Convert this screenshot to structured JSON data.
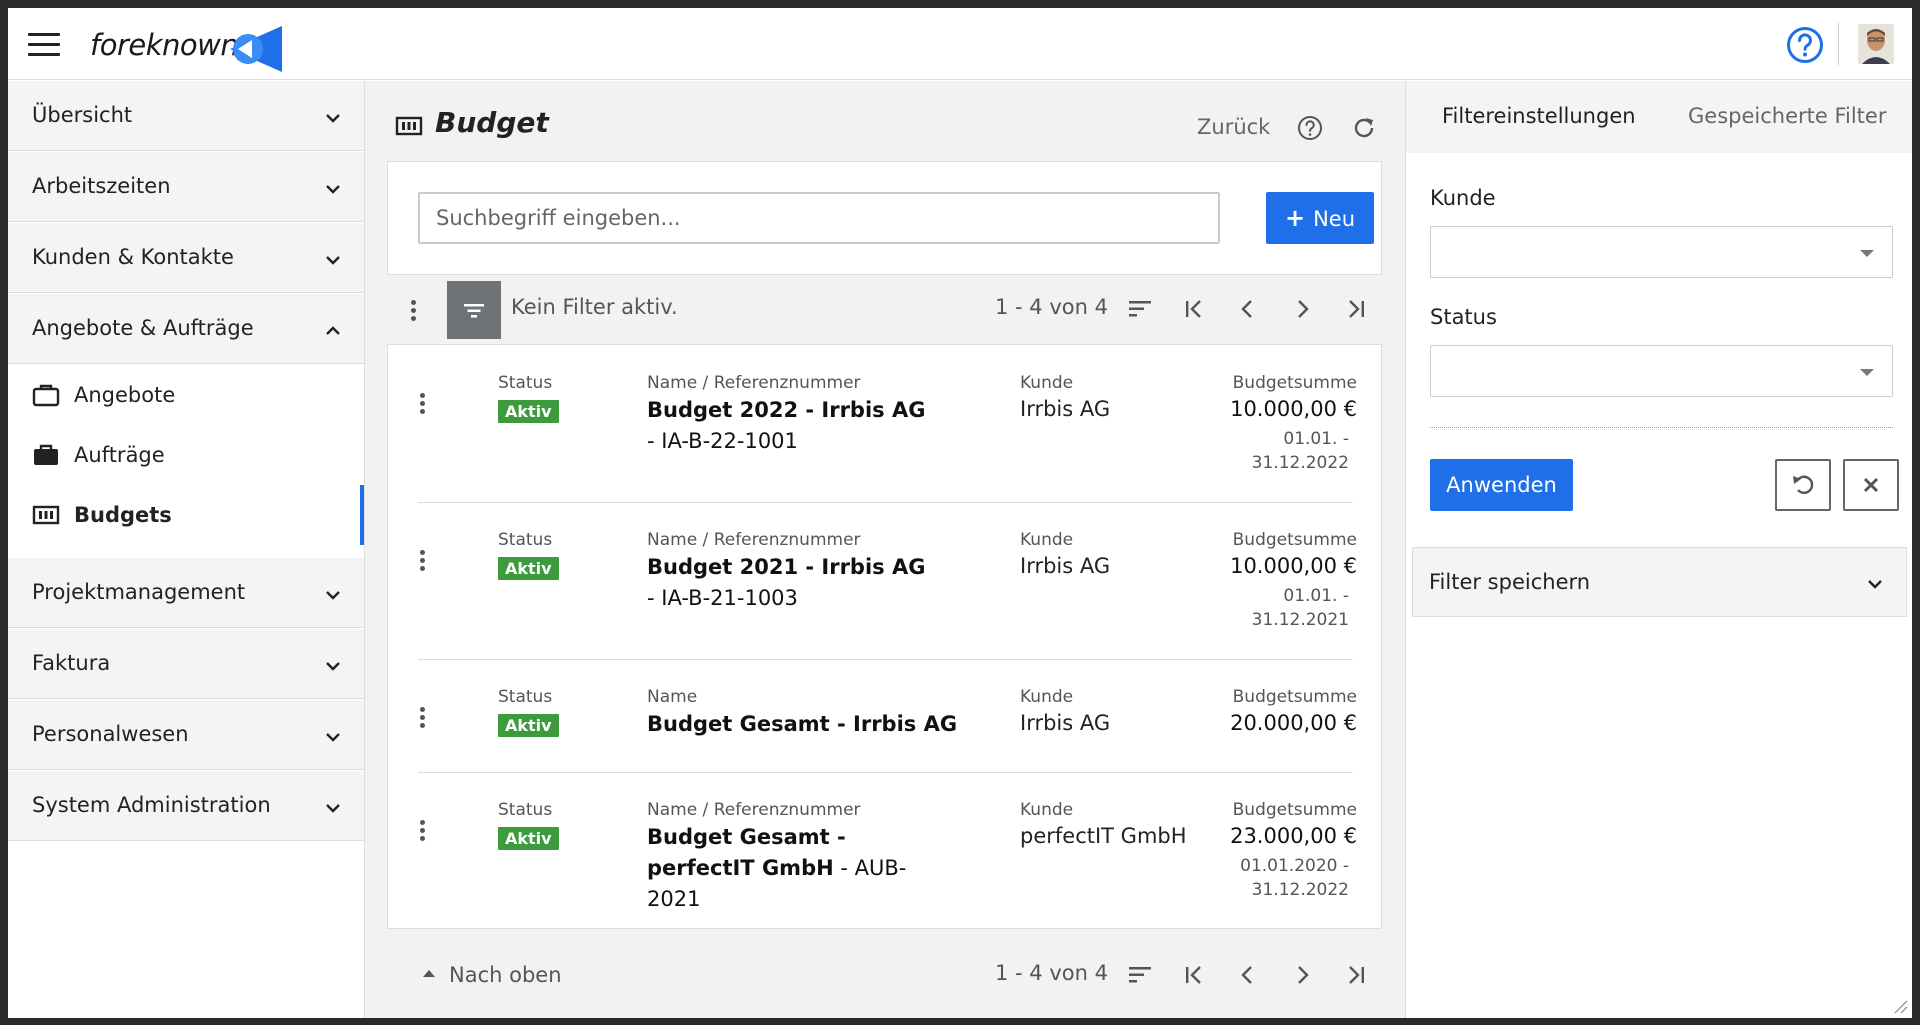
{
  "brand": {
    "name": "foreknown"
  },
  "sidebar": {
    "items": [
      {
        "label": "Übersicht"
      },
      {
        "label": "Arbeitszeiten"
      },
      {
        "label": "Kunden & Kontakte"
      },
      {
        "label": "Angebote & Aufträge"
      },
      {
        "label": "Projektmanagement"
      },
      {
        "label": "Faktura"
      },
      {
        "label": "Personalwesen"
      },
      {
        "label": "System Administration"
      }
    ],
    "subitems": [
      {
        "label": "Angebote",
        "icon": "briefcase-outline-icon"
      },
      {
        "label": "Aufträge",
        "icon": "briefcase-filled-icon"
      },
      {
        "label": "Budgets",
        "icon": "budget-icon",
        "active": true
      }
    ]
  },
  "header": {
    "title": "Budget",
    "back_label": "Zurück"
  },
  "search": {
    "placeholder": "Suchbegriff eingeben...",
    "new_label": "Neu"
  },
  "toolbar": {
    "filter_status": "Kein Filter aktiv.",
    "pager": "1 - 4 von 4"
  },
  "rows": [
    {
      "status_label": "Status",
      "status": "Aktiv",
      "name_label": "Name / Referenznummer",
      "name": "Budget 2022 - Irrbis AG",
      "ref": "- IA-B-22-1001",
      "customer_label": "Kunde",
      "customer": "Irrbis AG",
      "amount_label": "Budgetsumme",
      "amount": "10.000,00 €",
      "period": "01.01. - 31.12.2022"
    },
    {
      "status_label": "Status",
      "status": "Aktiv",
      "name_label": "Name / Referenznummer",
      "name": "Budget 2021 - Irrbis AG",
      "ref": "- IA-B-21-1003",
      "customer_label": "Kunde",
      "customer": "Irrbis AG",
      "amount_label": "Budgetsumme",
      "amount": "10.000,00 €",
      "period": "01.01. - 31.12.2021"
    },
    {
      "status_label": "Status",
      "status": "Aktiv",
      "name_label": "Name",
      "name": "Budget Gesamt - Irrbis AG",
      "ref": "",
      "customer_label": "Kunde",
      "customer": "Irrbis AG",
      "amount_label": "Budgetsumme",
      "amount": "20.000,00 €",
      "period": ""
    },
    {
      "status_label": "Status",
      "status": "Aktiv",
      "name_label": "Name / Referenznummer",
      "name": "Budget Gesamt - perfectIT GmbH",
      "ref": "- AUB-2021",
      "customer_label": "Kunde",
      "customer": "perfectIT GmbH",
      "amount_label": "Budgetsumme",
      "amount": "23.000,00 €",
      "period": "01.01.2020 - 31.12.2022"
    }
  ],
  "footer": {
    "to_top_label": "Nach oben",
    "pager": "1 - 4 von 4"
  },
  "filter_panel": {
    "tabs": [
      {
        "label": "Filtereinstellungen",
        "active": true
      },
      {
        "label": "Gespeicherte Filter",
        "active": false
      }
    ],
    "fields": [
      {
        "label": "Kunde",
        "value": ""
      },
      {
        "label": "Status",
        "value": ""
      }
    ],
    "apply_label": "Anwenden",
    "save_label": "Filter speichern"
  },
  "colors": {
    "primary": "#1e6fe8",
    "badge_active": "#3d9a3d",
    "filter_button": "#6e7378"
  }
}
